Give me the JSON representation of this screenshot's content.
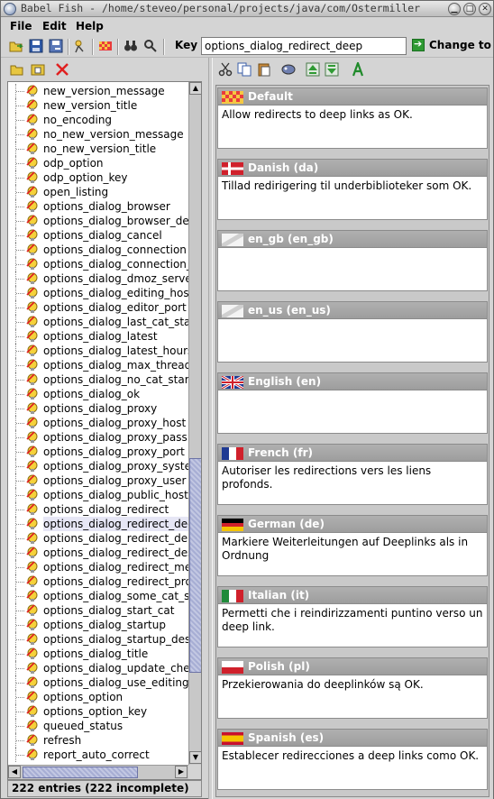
{
  "window": {
    "title": "Babel Fish - /home/steveo/personal/projects/java/com/Ostermiller"
  },
  "menubar": {
    "file": "File",
    "edit": "Edit",
    "help": "Help"
  },
  "toolbar": {
    "key_label": "Key",
    "key_value": "options_dialog_redirect_deep",
    "change_to": "Change to"
  },
  "tree": {
    "items": [
      "new_version_message",
      "new_version_title",
      "no_encoding",
      "no_new_version_message",
      "no_new_version_title",
      "odp_option",
      "odp_option_key",
      "open_listing",
      "options_dialog_browser",
      "options_dialog_browser_desc",
      "options_dialog_cancel",
      "options_dialog_connection",
      "options_dialog_connection_desc",
      "options_dialog_dmoz_server",
      "options_dialog_editing_host",
      "options_dialog_editor_port",
      "options_dialog_last_cat_start",
      "options_dialog_latest",
      "options_dialog_latest_hours",
      "options_dialog_max_threads",
      "options_dialog_no_cat_start",
      "options_dialog_ok",
      "options_dialog_proxy",
      "options_dialog_proxy_host",
      "options_dialog_proxy_pass",
      "options_dialog_proxy_port",
      "options_dialog_proxy_system",
      "options_dialog_proxy_user",
      "options_dialog_public_host",
      "options_dialog_redirect",
      "options_dialog_redirect_deep",
      "options_dialog_redirect_deny",
      "options_dialog_redirect_desc",
      "options_dialog_redirect_meta",
      "options_dialog_redirect_proxy",
      "options_dialog_some_cat_start",
      "options_dialog_start_cat",
      "options_dialog_startup",
      "options_dialog_startup_desc",
      "options_dialog_title",
      "options_dialog_update_check",
      "options_dialog_use_editing_host",
      "options_option",
      "options_option_key",
      "queued_status",
      "refresh",
      "report_auto_correct"
    ],
    "selected_index": 30
  },
  "status": {
    "text": "222 entries (222 incomplete)"
  },
  "translations": [
    {
      "name": "Default",
      "flag": "default",
      "text": "Allow redirects to deep links as OK."
    },
    {
      "name": "Danish (da)",
      "flag": "danish",
      "text": "Tillad redirigering til underbiblioteker som OK."
    },
    {
      "name": "en_gb (en_gb)",
      "flag": "blank",
      "text": ""
    },
    {
      "name": "en_us (en_us)",
      "flag": "blank",
      "text": ""
    },
    {
      "name": "English (en)",
      "flag": "uk",
      "text": ""
    },
    {
      "name": "French (fr)",
      "flag": "french",
      "text": "Autoriser les redirections vers les liens profonds."
    },
    {
      "name": "German (de)",
      "flag": "german",
      "text": "Markiere Weiterleitungen auf Deeplinks als in Ordnung"
    },
    {
      "name": "Italian (it)",
      "flag": "italian",
      "text": "Permetti che i reindirizzamenti puntino verso un deep link."
    },
    {
      "name": "Polish (pl)",
      "flag": "polish",
      "text": "Przekierowania do deeplinków są OK."
    },
    {
      "name": "Spanish (es)",
      "flag": "spanish",
      "text": "Establecer redirecciones a deep links como OK."
    }
  ]
}
